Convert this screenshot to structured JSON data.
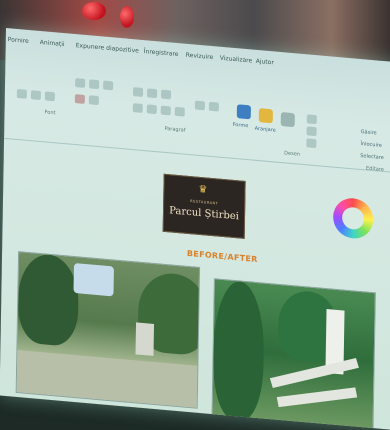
{
  "ribbon": {
    "tabs": [
      "Pornire",
      "Animații",
      "Expunere diapozitive",
      "Înregistrare",
      "Revizuire",
      "Vizualizare",
      "Ajutor"
    ],
    "groups": {
      "font": "Font",
      "paragraph": "Paragraf",
      "drawing": "Desen",
      "editing": "Editare"
    },
    "buttons": {
      "shapes": "Forme",
      "arrange": "Aranjare",
      "find": "Găsire",
      "replace": "Înlocuire",
      "select": "Selectare"
    }
  },
  "slide": {
    "logo_small": "RESTAURANT",
    "logo_name": "Parcul Știrbei",
    "title": "BEFORE/AFTER"
  },
  "colors": {
    "slide_bg": "#d7e9e4",
    "title_orange": "#d9822b",
    "logo_bg": "#2c2622"
  }
}
